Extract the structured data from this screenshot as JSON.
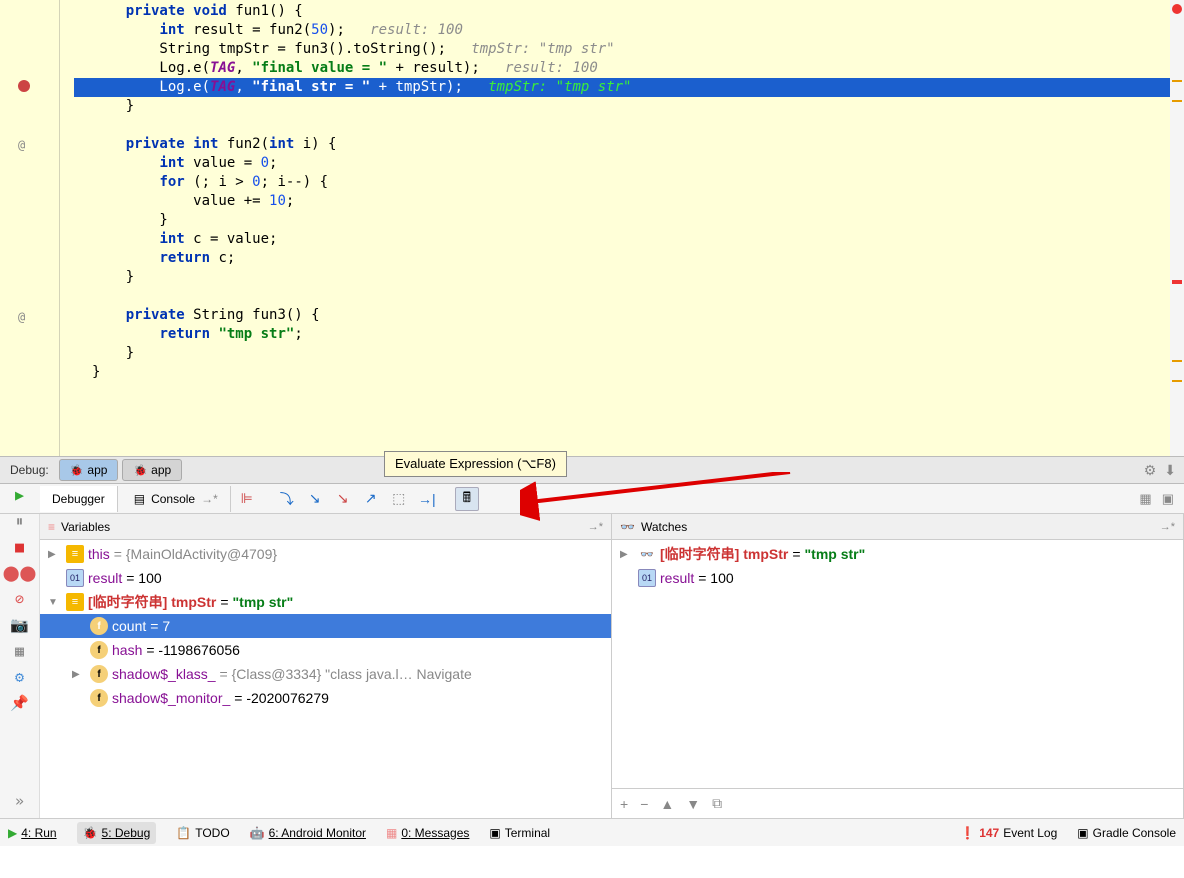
{
  "code": {
    "lines": [
      {
        "raw": "    private void fun1() {",
        "parts": [
          [
            "    ",
            ""
          ],
          [
            "private void",
            "kw"
          ],
          [
            " fun1() {",
            ""
          ]
        ]
      },
      {
        "parts": [
          [
            "        ",
            ""
          ],
          [
            "int",
            "kw"
          ],
          [
            " result = fun2(",
            ""
          ],
          [
            "50",
            "num"
          ],
          [
            ");",
            ""
          ],
          [
            "   result: 100",
            "hint"
          ]
        ]
      },
      {
        "parts": [
          [
            "        String tmpStr = fun3().toString();",
            ""
          ],
          [
            "   tmpStr: \"tmp str\"",
            "hint"
          ]
        ]
      },
      {
        "parts": [
          [
            "        Log.e(",
            ""
          ],
          [
            "TAG",
            "tag"
          ],
          [
            ", ",
            ""
          ],
          [
            "\"final value = \"",
            "str"
          ],
          [
            " + result);",
            ""
          ],
          [
            "   result: 100",
            "hint"
          ]
        ]
      },
      {
        "selected": true,
        "parts": [
          [
            "        Log.e(",
            ""
          ],
          [
            "TAG",
            "tag"
          ],
          [
            ", ",
            ""
          ],
          [
            "\"final str = \"",
            "str"
          ],
          [
            " + tmpStr);",
            ""
          ],
          [
            "   tmpStr: \"tmp str\"",
            "hint"
          ]
        ]
      },
      {
        "parts": [
          [
            "    }",
            ""
          ]
        ]
      },
      {
        "parts": [
          [
            "",
            ""
          ]
        ]
      },
      {
        "parts": [
          [
            "    ",
            ""
          ],
          [
            "private int",
            "kw"
          ],
          [
            " fun2(",
            ""
          ],
          [
            "int",
            "kw"
          ],
          [
            " i) {",
            ""
          ]
        ]
      },
      {
        "parts": [
          [
            "        ",
            ""
          ],
          [
            "int",
            "kw"
          ],
          [
            " value = ",
            ""
          ],
          [
            "0",
            "num"
          ],
          [
            ";",
            ""
          ]
        ]
      },
      {
        "parts": [
          [
            "        ",
            ""
          ],
          [
            "for",
            "kw"
          ],
          [
            " (; i > ",
            ""
          ],
          [
            "0",
            "num"
          ],
          [
            "; i--) {",
            ""
          ]
        ]
      },
      {
        "parts": [
          [
            "            value += ",
            ""
          ],
          [
            "10",
            "num"
          ],
          [
            ";",
            ""
          ]
        ]
      },
      {
        "parts": [
          [
            "        }",
            ""
          ]
        ]
      },
      {
        "parts": [
          [
            "        ",
            ""
          ],
          [
            "int",
            "kw"
          ],
          [
            " c = value;",
            ""
          ]
        ]
      },
      {
        "parts": [
          [
            "        ",
            ""
          ],
          [
            "return",
            "kw"
          ],
          [
            " c;",
            ""
          ]
        ]
      },
      {
        "parts": [
          [
            "    }",
            ""
          ]
        ]
      },
      {
        "parts": [
          [
            "",
            ""
          ]
        ]
      },
      {
        "parts": [
          [
            "    ",
            ""
          ],
          [
            "private",
            "kw"
          ],
          [
            " String fun3() {",
            ""
          ]
        ]
      },
      {
        "parts": [
          [
            "        ",
            ""
          ],
          [
            "return ",
            "kw"
          ],
          [
            "\"tmp str\"",
            "str"
          ],
          [
            ";",
            ""
          ]
        ]
      },
      {
        "parts": [
          [
            "    }",
            ""
          ]
        ]
      },
      {
        "parts": [
          [
            "}",
            ""
          ]
        ]
      }
    ]
  },
  "tabstrip": {
    "label": "Debug:",
    "tab1": "app",
    "tab2": "app",
    "tooltip": "Evaluate Expression (⌥F8)"
  },
  "debugtabs": {
    "debugger": "Debugger",
    "console": "Console"
  },
  "panels": {
    "variables_title": "Variables",
    "watches_title": "Watches"
  },
  "variables": [
    {
      "indent": 0,
      "exp": "▶",
      "icon": "obj",
      "iconText": "≡",
      "name": "this",
      "val": " = {MainOldActivity@4709}",
      "valClass": "vobj"
    },
    {
      "indent": 0,
      "exp": "",
      "icon": "prim",
      "iconText": "01",
      "name": "result",
      "val": " = 100"
    },
    {
      "indent": 0,
      "exp": "▼",
      "icon": "obj",
      "iconText": "≡",
      "name": "[临时字符串] tmpStr",
      "nameClass": "watch",
      "val": " = ",
      "strVal": "\"tmp str\""
    },
    {
      "indent": 1,
      "exp": "",
      "icon": "field",
      "iconText": "f",
      "name": " count",
      "val": " = 7",
      "selected": true
    },
    {
      "indent": 1,
      "exp": "",
      "icon": "field",
      "iconText": "f",
      "name": " hash",
      "val": " = -1198676056"
    },
    {
      "indent": 1,
      "exp": "▶",
      "icon": "field",
      "iconText": "f",
      "name": " shadow$_klass_",
      "val": " = {Class@3334} \"class java.l… Navigate",
      "valClass": "vobj"
    },
    {
      "indent": 1,
      "exp": "",
      "icon": "field",
      "iconText": "f",
      "name": " shadow$_monitor_",
      "val": " = -2020076279"
    }
  ],
  "watches": [
    {
      "exp": "▶",
      "icon": "watch",
      "iconText": "👓",
      "name": "[临时字符串] tmpStr",
      "nameClass": "watch",
      "val": " = ",
      "strVal": "\"tmp str\""
    },
    {
      "exp": "",
      "icon": "prim",
      "iconText": "01",
      "name": "result",
      "val": " = 100"
    }
  ],
  "bottombar": {
    "run": "4: Run",
    "debug": "5: Debug",
    "todo": "TODO",
    "android": "6: Android Monitor",
    "messages": "0: Messages",
    "terminal": "Terminal",
    "eventlog": "Event Log",
    "eventcount": "147",
    "gradle": "Gradle Console"
  }
}
